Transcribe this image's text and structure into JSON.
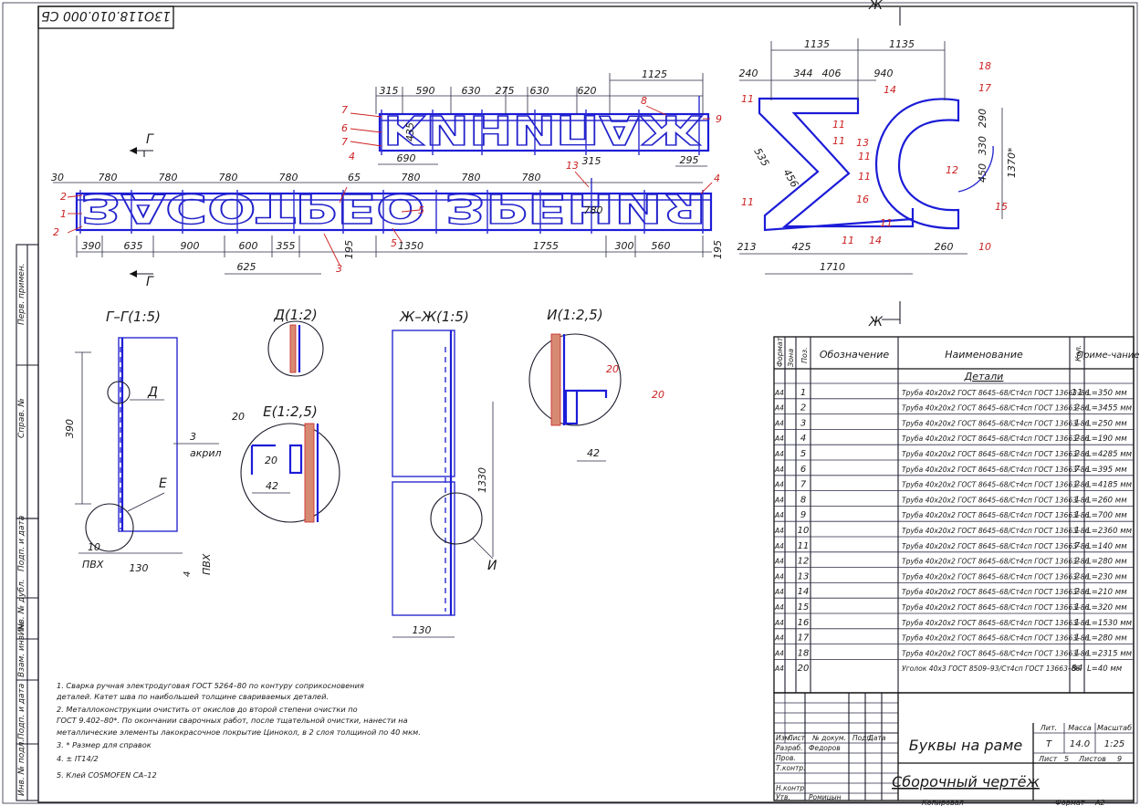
{
  "stamp_code": "13О118.010.000 СБ",
  "dims": {
    "top_row1": [
      "315",
      "590",
      "630",
      "275",
      "630",
      "620"
    ],
    "top_1125": "1125",
    "top_435": "435",
    "top_690": "690",
    "top_295": "295",
    "mid_row": [
      "30",
      "780",
      "780",
      "780",
      "780",
      "65",
      "780",
      "780",
      "780",
      "780"
    ],
    "mid_315": "315",
    "mid_780": "780",
    "bot_row": [
      "390",
      "635",
      "900",
      "600",
      "355",
      "1350",
      "1755",
      "300",
      "560"
    ],
    "bot_625": "625",
    "bot_195a": "195",
    "bot_195b": "195",
    "right_top": [
      "1135",
      "1135"
    ],
    "right_row": [
      "240",
      "344",
      "406",
      "940"
    ],
    "right_535": "535",
    "right_456": "456",
    "right_290": "290",
    "right_330": "330",
    "right_450": "450",
    "right_1370": "1370*",
    "right_bot": [
      "213",
      "425",
      "260"
    ],
    "right_1710": "1710"
  },
  "callouts": {
    "left": [
      "2",
      "1",
      "2",
      "4",
      "5",
      "5",
      "3",
      "4",
      "13"
    ],
    "top": [
      "7",
      "6",
      "7",
      "8",
      "9"
    ],
    "right": [
      "11",
      "11",
      "11",
      "11",
      "13",
      "14",
      "18",
      "17",
      "11",
      "11",
      "12",
      "16",
      "15",
      "11",
      "14",
      "10",
      "11"
    ]
  },
  "sign_text": {
    "line1": "КИНИПАЖ",
    "line2": "ЗАСОТРЕО ЗРЕНИЯ"
  },
  "section_marks": {
    "g_top": "Г",
    "g_bottom": "Г",
    "zh_top": "Ж",
    "zh_bottom": "Ж"
  },
  "views": {
    "gg": {
      "title": "Г–Г(1:5)",
      "d390": "390",
      "d10": "10",
      "pvh1": "ПВХ",
      "d130": "130",
      "d4": "4",
      "pvh2": "ПВХ",
      "d3": "3",
      "akril": "акрил",
      "lblD": "Д",
      "lblE": "Е"
    },
    "d": {
      "title": "Д(1:2)"
    },
    "e": {
      "title": "Е(1:2,5)",
      "n20a": "20",
      "n20b": "20",
      "d42": "42"
    },
    "zhzh": {
      "title": "Ж–Ж(1:5)",
      "d1330": "1330",
      "d130": "130",
      "lblI": "И"
    },
    "i": {
      "title": "И(1:2,5)",
      "n20a": "20",
      "n20b": "20",
      "d42": "42"
    }
  },
  "notes": [
    "1. Сварка ручная электродуговая ГОСТ 5264–80 по контуру соприкосновения",
    "деталей. Катет шва по наибольшей толщине свариваемых деталей.",
    "2. Металлоконструкции очистить от окислов до второй степени очистки по",
    "ГОСТ 9.402–80*. По окончании сварочных работ, после тщательной очистки, нанести на",
    "металлические элементы лакокрасочное покрытие Цинокол, в 2 слоя толщиной по 40 мкм.",
    "3. * Размер для справок",
    "4. ± IT14/2",
    "5. Клей COSMOFEN CA–12"
  ],
  "side_stamps": [
    "Перв. примен.",
    "Справ. №",
    "Подп. и дата",
    "Инв. № дубл.",
    "Взам. инв. №",
    "Подп. и дата",
    "Инв. № подл."
  ],
  "spec": {
    "headers": {
      "format": "Формат",
      "zone": "Зона",
      "pos": "Поз.",
      "designation": "Обозначение",
      "name": "Наименование",
      "qty": "Кол.",
      "note": "Приме-чание"
    },
    "section": "Детали",
    "rows": [
      {
        "f": "А4",
        "pos": "1",
        "name": "Труба 40х20х2 ГОСТ 8645–68/Ст4сп ГОСТ 13663–86",
        "qty": "11",
        "note": "L=350 мм"
      },
      {
        "f": "А4",
        "pos": "2",
        "name": "Труба 40х20х2 ГОСТ 8645–68/Ст4сп ГОСТ 13663–86",
        "qty": "2",
        "note": "L=3455 мм"
      },
      {
        "f": "А4",
        "pos": "3",
        "name": "Труба 40х20х2 ГОСТ 8645–68/Ст4сп ГОСТ 13663–86",
        "qty": "1",
        "note": "L=250 мм"
      },
      {
        "f": "А4",
        "pos": "4",
        "name": "Труба 40х20х2 ГОСТ 8645–68/Ст4сп ГОСТ 13663–86",
        "qty": "2",
        "note": "L=190 мм"
      },
      {
        "f": "А4",
        "pos": "5",
        "name": "Труба 40х20х2 ГОСТ 8645–68/Ст4сп ГОСТ 13663–86",
        "qty": "2",
        "note": "L=4285 мм"
      },
      {
        "f": "А4",
        "pos": "6",
        "name": "Труба 40х20х2 ГОСТ 8645–68/Ст4сп ГОСТ 13663–86",
        "qty": "7",
        "note": "L=395 мм"
      },
      {
        "f": "А4",
        "pos": "7",
        "name": "Труба 40х20х2 ГОСТ 8645–68/Ст4сп ГОСТ 13663–86",
        "qty": "2",
        "note": "L=4185 мм"
      },
      {
        "f": "А4",
        "pos": "8",
        "name": "Труба 40х20х2 ГОСТ 8645–68/Ст4сп ГОСТ 13663–86",
        "qty": "1",
        "note": "L=260 мм"
      },
      {
        "f": "А4",
        "pos": "9",
        "name": "Труба 40х20х2 ГОСТ 8645–68/Ст4сп ГОСТ 13663–86",
        "qty": "1",
        "note": "L=700 мм"
      },
      {
        "f": "А4",
        "pos": "10",
        "name": "Труба 40х20х2 ГОСТ 8645–68/Ст4сп ГОСТ 13663–86",
        "qty": "1",
        "note": "L=2360 мм"
      },
      {
        "f": "А4",
        "pos": "11",
        "name": "Труба 40х20х2 ГОСТ 8645–68/Ст4сп ГОСТ 13663–86",
        "qty": "7",
        "note": "L=140 мм"
      },
      {
        "f": "А4",
        "pos": "12",
        "name": "Труба 40х20х2 ГОСТ 8645–68/Ст4сп ГОСТ 13663–86",
        "qty": "2",
        "note": "L=280 мм"
      },
      {
        "f": "А4",
        "pos": "13",
        "name": "Труба 40х20х2 ГОСТ 8645–68/Ст4сп ГОСТ 13663–86",
        "qty": "2",
        "note": "L=230 мм"
      },
      {
        "f": "А4",
        "pos": "14",
        "name": "Труба 40х20х2 ГОСТ 8645–68/Ст4сп ГОСТ 13663–86",
        "qty": "2",
        "note": "L=210 мм"
      },
      {
        "f": "А4",
        "pos": "15",
        "name": "Труба 40х20х2 ГОСТ 8645–68/Ст4сп ГОСТ 13663–86",
        "qty": "1",
        "note": "L=320 мм"
      },
      {
        "f": "А4",
        "pos": "16",
        "name": "Труба 40х20х2 ГОСТ 8645–68/Ст4сп ГОСТ 13663–86",
        "qty": "1",
        "note": "L=1530 мм"
      },
      {
        "f": "А4",
        "pos": "17",
        "name": "Труба 40х20х2 ГОСТ 8645–68/Ст4сп ГОСТ 13663–86",
        "qty": "1",
        "note": "L=280 мм"
      },
      {
        "f": "А4",
        "pos": "18",
        "name": "Труба 40х20х2 ГОСТ 8645–68/Ст4сп ГОСТ 13663–86",
        "qty": "1",
        "note": "L=2315 мм"
      },
      {
        "f": "А4",
        "pos": "20",
        "name": "Уголок 40х3 ГОСТ 8509–93/Ст4сп ГОСТ 13663–86",
        "qty": "84",
        "note": "L=40 мм"
      }
    ]
  },
  "title_block": {
    "izm": "Изм.",
    "list": "Лист",
    "ndoc": "№ докум.",
    "podp": "Подп.",
    "data": "Дата",
    "razrab": "Разраб.",
    "razrab_name": "Федоров",
    "prov": "Пров.",
    "tkontr": "Т.контр.",
    "nkontr": "Н.контр.",
    "utv": "Утв.",
    "utv_name": "Ромицын",
    "title1": "Буквы на раме",
    "title2": "Сборочный чертёж",
    "lit": "Лит.",
    "lit_val": "Т",
    "massa": "Масса",
    "massa_val": "14.0",
    "masshtab": "Масштаб",
    "masshtab_val": "1:25",
    "list_label": "Лист",
    "list_val": "5",
    "listov_label": "Листов",
    "listov_val": "9",
    "kopiroval": "Копировал",
    "format": "Формат",
    "format_val": "А2"
  }
}
